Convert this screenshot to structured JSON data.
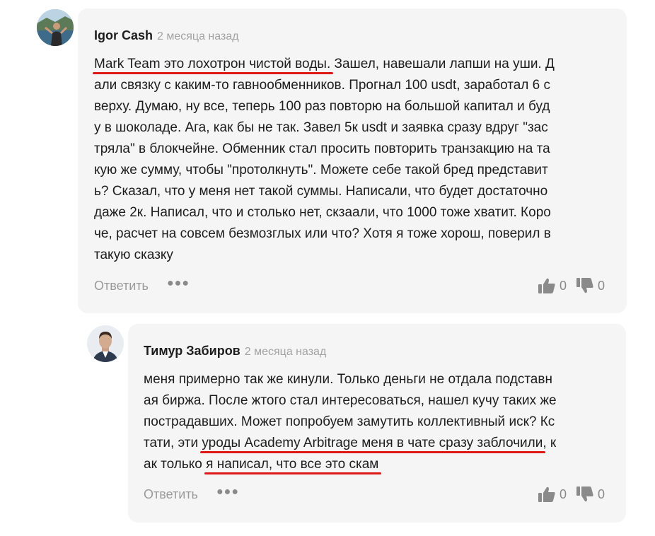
{
  "comments": [
    {
      "author": "Igor Cash",
      "time": "2 месяца назад",
      "line0": {
        "pre": "",
        "u": "Mark Team это лохотрон чистой воды.",
        "post": " Зашел, навешали лапши на уши. Д"
      },
      "lines": [
        "али связку с каким-то гавнообменников. Прогнал 100 usdt, заработал 6 с",
        "верху. Думаю, ну все, теперь 100 раз повторю на большой капитал и буд",
        "у в шоколаде. Ага, как бы не так. Завел 5к usdt и заявка сразу вдруг \"зас",
        "тряла\" в блокчейне. Обменник стал просить повторить транзакцию на та",
        "кую же сумму, чтобы \"протолкнуть\". Можете себе такой бред представит",
        "ь? Сказал, что у меня нет такой суммы. Написали, что будет достаточно",
        "даже 2к. Написал, что и столько нет, скзаали, что 1000 тоже хватит. Коро",
        "че, расчет на совсем безмозглых или что? Хотя я тоже хорош, поверил в",
        "такую сказку"
      ],
      "reply_label": "Ответить",
      "likes": "0",
      "dislikes": "0"
    },
    {
      "author": "Тимур Забиров",
      "time": "2 месяца назад",
      "lines": [
        "меня примерно так же кинули. Только деньги не отдала подставн",
        "ая биржа. После жтого стал интересоваться, нашел кучу таких же",
        "пострадавших. Может попробуем замутить коллективный иск? Кс"
      ],
      "line3": {
        "pre": "тати, эти ",
        "u": "уроды Academy Arbitrage меня в чате сразу заблочили",
        "post": ", к"
      },
      "line4": {
        "pre": "ак только ",
        "u": "я написал, что все это скам",
        "post": ""
      },
      "reply_label": "Ответить",
      "likes": "0",
      "dislikes": "0"
    }
  ],
  "icons": {
    "more": "more-dots-icon",
    "like": "thumbs-up-icon",
    "dislike": "thumbs-down-icon"
  },
  "colors": {
    "card_bg": "#f5f5f5",
    "underline": "#e01717",
    "muted": "#9a9a9a"
  }
}
